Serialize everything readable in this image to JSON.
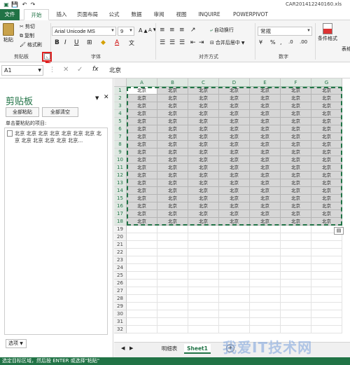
{
  "window": {
    "title": "CAR201412240160.xls"
  },
  "ribbon": {
    "tabs": [
      {
        "label": "文件"
      },
      {
        "label": "开始"
      },
      {
        "label": "插入"
      },
      {
        "label": "页面布局"
      },
      {
        "label": "公式"
      },
      {
        "label": "数据"
      },
      {
        "label": "审阅"
      },
      {
        "label": "视图"
      },
      {
        "label": "INQUIRE"
      },
      {
        "label": "POWERPIVOT"
      }
    ],
    "clipboard": {
      "paste": "粘贴",
      "cut": "剪切",
      "copy": "复制",
      "format_painter": "格式刷",
      "group": "剪贴板"
    },
    "font": {
      "name": "Arial Unicode MS",
      "size": "9",
      "bold": "B",
      "italic": "I",
      "underline": "U",
      "font_color": "A",
      "group": "字体"
    },
    "align": {
      "wrap": "自动换行",
      "merge": "合并后居中",
      "group": "对齐方式"
    },
    "number": {
      "format": "常规",
      "group": "数字"
    },
    "styles": {
      "cond": "条件格式",
      "table": "表格"
    }
  },
  "formula_bar": {
    "name_box": "A1",
    "fx": "fx",
    "value": "北京"
  },
  "clipboard_pane": {
    "title": "剪贴板",
    "paste_all": "全部粘贴",
    "clear_all": "全部清空",
    "hint": "单击要粘贴的项目:",
    "item_text": "北京 北京 北京 北京 北京 北京 北京 北京 北京 北京 北京 北京 北京...",
    "options": "选项"
  },
  "sheet": {
    "columns": [
      "A",
      "B",
      "C",
      "D",
      "E",
      "F",
      "G"
    ],
    "rows": [
      "1",
      "2",
      "3",
      "4",
      "5",
      "6",
      "7",
      "8",
      "9",
      "10",
      "11",
      "12",
      "13",
      "14",
      "15",
      "16",
      "17",
      "18",
      "19",
      "20",
      "21",
      "22",
      "23",
      "24",
      "25",
      "26",
      "27",
      "28",
      "29",
      "30",
      "31",
      "32"
    ],
    "filled_rows": 18,
    "cell_value": "北京"
  },
  "sheet_tabs": [
    {
      "label": "明细表"
    },
    {
      "label": "Sheet1"
    }
  ],
  "status": {
    "text": "选定目标区域，然后按 ENTER 或选择\"粘贴\""
  },
  "watermark": {
    "text": "我爱IT技术网"
  },
  "colors": {
    "accent": "#217346",
    "highlight": "#e02020"
  }
}
